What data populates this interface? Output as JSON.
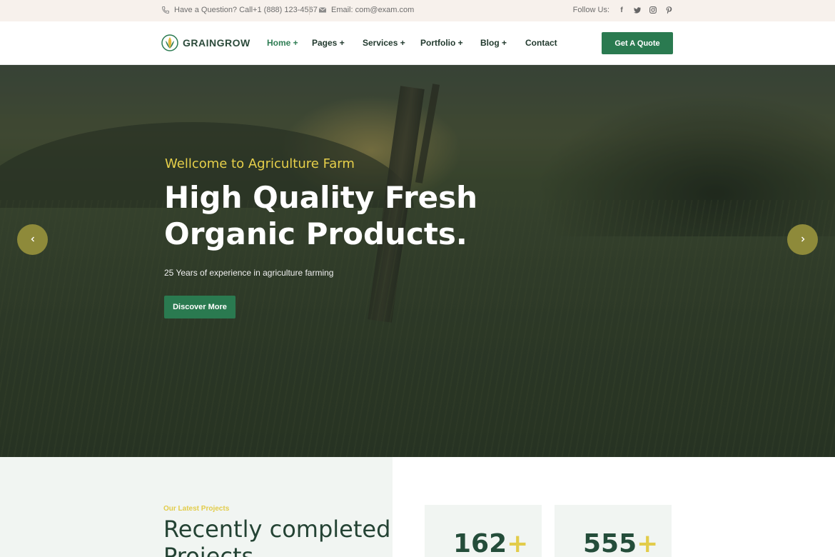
{
  "topbar": {
    "question": "Have a Question? Call+1 (888) 123-4567",
    "email": "Email: com@exam.com",
    "follow_label": "Follow Us:",
    "social": [
      "f",
      "t",
      "ig",
      "p"
    ]
  },
  "header": {
    "logo_text": "GRAINGROW",
    "nav": [
      {
        "label": "Home +"
      },
      {
        "label": "Pages +"
      },
      {
        "label": "Services +"
      },
      {
        "label": "Portfolio +"
      },
      {
        "label": "Blog +"
      },
      {
        "label": "Contact"
      }
    ],
    "quote_label": "Get A Quote",
    "accent": "#2a7a50"
  },
  "hero": {
    "subtitle": "Wellcome to Agriculture Farm",
    "title_line1": "High Quality Fresh",
    "title_line2": "Organic Products.",
    "description": "25 Years of experience in agriculture farming",
    "button_label": "Discover More",
    "prev_icon": "chevron-left-icon",
    "next_icon": "chevron-right-icon"
  },
  "projects": {
    "eyebrow": "Our Latest Projects",
    "title_line1": "Recently completed",
    "title_line2": "Projects",
    "stats": [
      {
        "value": "162",
        "suffix": "+"
      },
      {
        "value": "555",
        "suffix": "+"
      }
    ]
  }
}
